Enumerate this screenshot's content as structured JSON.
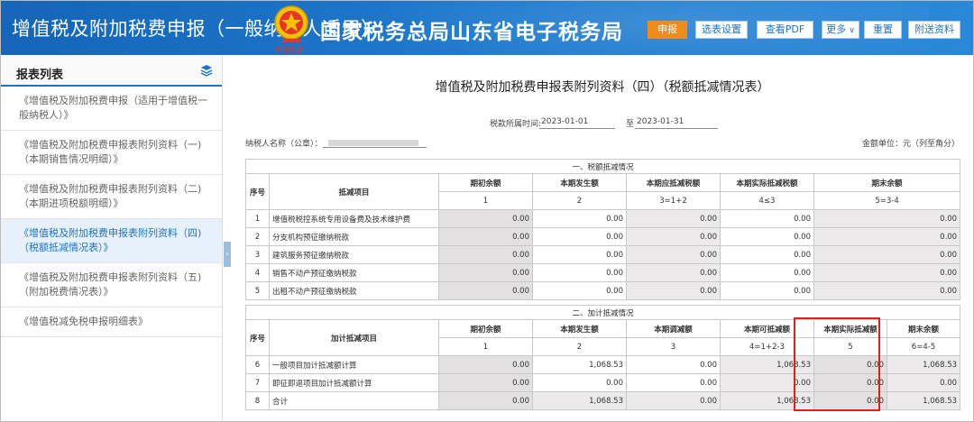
{
  "header": {
    "app_title": "增值税及附加税费申报（一般纳税人适用）",
    "emblem_text": "中国税务",
    "bureau": "国家税务总局山东省电子税务局",
    "buttons": [
      {
        "label": "申报"
      },
      {
        "label": "选表设置"
      },
      {
        "label": "查看PDF"
      },
      {
        "label": "更多"
      },
      {
        "label": "重置"
      },
      {
        "label": "附送资料"
      }
    ]
  },
  "sidebar": {
    "title": "报表列表",
    "items": [
      {
        "label": "《增值税及附加税费申报（适用于增值税一般纳税人）》"
      },
      {
        "label": "《增值税及附加税费申报表附列资料（一)（本期销售情况明细）》"
      },
      {
        "label": "《增值税及附加税费申报表附列资料（二)（本期进项税额明细）》"
      },
      {
        "label": "《增值税及附加税费申报表附列资料（四)（税额抵减情况表）》"
      },
      {
        "label": "《增值税及附加税费申报表附列资料（五)（附加税费情况表）》"
      },
      {
        "label": "《增值税减免税申报明细表》"
      }
    ],
    "active_index": 3
  },
  "form": {
    "title": "增值税及附加税费申报表附列资料（四）（税额抵减情况表）",
    "period_label": "税款所属时间:",
    "period_from": "2023-01-01",
    "period_to_label": "至",
    "period_to": "2023-01-31",
    "taxpayer_label": "纳税人名称（公章）：",
    "unit": "金额单位：元（列至角分）"
  },
  "section1": {
    "title": "一、税额抵减情况",
    "seq_header": "序号",
    "item_header": "抵减项目",
    "columns": [
      "期初余额",
      "本期发生额",
      "本期应抵减税额",
      "本期实际抵减税额",
      "期末余额"
    ],
    "formulas": [
      "1",
      "2",
      "3=1+2",
      "4≤3",
      "5=3-4"
    ],
    "rows": [
      {
        "no": "1",
        "name": "增值税税控系统专用设备费及技术维护费",
        "v": [
          "0.00",
          "0.00",
          "0.00",
          "0.00",
          "0.00"
        ]
      },
      {
        "no": "2",
        "name": "分支机构预征缴纳税款",
        "v": [
          "0.00",
          "0.00",
          "0.00",
          "0.00",
          "0.00"
        ]
      },
      {
        "no": "3",
        "name": "建筑服务预征缴纳税款",
        "v": [
          "0.00",
          "0.00",
          "0.00",
          "0.00",
          "0.00"
        ]
      },
      {
        "no": "4",
        "name": "销售不动产预征缴纳税款",
        "v": [
          "0.00",
          "0.00",
          "0.00",
          "0.00",
          "0.00"
        ]
      },
      {
        "no": "5",
        "name": "出租不动产预征缴纳税款",
        "v": [
          "0.00",
          "0.00",
          "0.00",
          "0.00",
          "0.00"
        ]
      }
    ]
  },
  "section2": {
    "title": "二、加计抵减情况",
    "seq_header": "序号",
    "item_header": "加计抵减项目",
    "columns": [
      "期初余额",
      "本期发生额",
      "本期调减额",
      "本期可抵减额",
      "本期实际抵减额",
      "期末余额"
    ],
    "formulas": [
      "1",
      "2",
      "3",
      "4=1+2-3",
      "5",
      "6=4-5"
    ],
    "rows": [
      {
        "no": "6",
        "name": "一般项目加计抵减额计算",
        "v": [
          "0.00",
          "1,068.53",
          "0.00",
          "1,068.53",
          "0.00",
          "1,068.53"
        ]
      },
      {
        "no": "7",
        "name": "即征即退项目加计抵减额计算",
        "v": [
          "0.00",
          "0.00",
          "0.00",
          "0.00",
          "0.00",
          "0.00"
        ]
      },
      {
        "no": "8",
        "name": "合计",
        "v": [
          "0.00",
          "1,068.53",
          "0.00",
          "1,068.53",
          "0.00",
          "1,068.53"
        ]
      }
    ]
  },
  "colors": {
    "header_blue": "#1e78cc",
    "primary_orange": "#f08b1a",
    "highlight_red": "#e0201c",
    "active_item": "#1a73c8"
  }
}
